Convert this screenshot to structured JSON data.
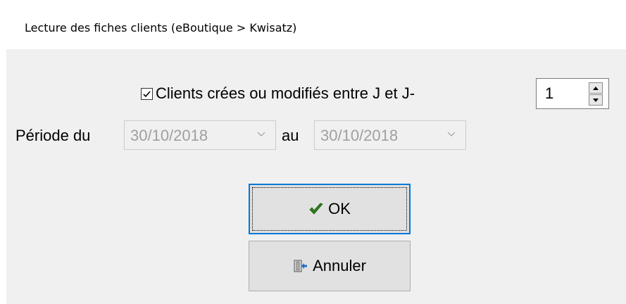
{
  "window": {
    "title": "Lecture des fiches clients (eBoutique > Kwisatz)"
  },
  "filter": {
    "checkbox_label": "Clients crées ou modifiés entre J et J-",
    "checked": true,
    "days_value": "1"
  },
  "period": {
    "from_label": "Période du",
    "from_value": "30/10/2018",
    "to_label": "au",
    "to_value": "30/10/2018"
  },
  "buttons": {
    "ok_label": "OK",
    "cancel_label": "Annuler"
  },
  "icons": {
    "ok": "checkmark-icon",
    "cancel": "exit-door-icon"
  },
  "colors": {
    "panel_bg": "#f0f0f0",
    "focus_border": "#0078d7",
    "ok_check": "#2e7d1e",
    "disabled_text": "#a0a0a0"
  }
}
